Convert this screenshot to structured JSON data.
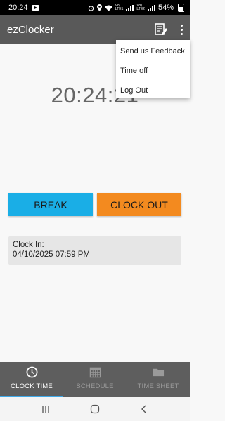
{
  "status_bar": {
    "time": "20:24",
    "battery": "54%",
    "icons": [
      "youtube-icon",
      "alarm-icon",
      "location-icon",
      "wifi-icon",
      "signal-icon",
      "signal-icon",
      "battery-icon"
    ],
    "lte_label_1": "Vo)",
    "lte_label_2": "LTE1",
    "lte_label_3": "Vo)",
    "lte_label_4": "LTE2"
  },
  "app_bar": {
    "title": "ezClocker",
    "actions": [
      "notes-icon",
      "more-vert-icon"
    ]
  },
  "menu": {
    "items": [
      {
        "label": "Send us Feedback"
      },
      {
        "label": "Time off"
      },
      {
        "label": "Log Out"
      }
    ]
  },
  "main": {
    "clock_time": "20:24:21",
    "break_label": "BREAK",
    "clock_out_label": "CLOCK OUT",
    "clock_in_label": "Clock In:",
    "clock_in_value": "04/10/2025 07:59 PM"
  },
  "bottom_nav": {
    "tabs": [
      {
        "label": "CLOCK TIME",
        "icon": "clock-icon",
        "active": true
      },
      {
        "label": "SCHEDULE",
        "icon": "calendar-icon",
        "active": false
      },
      {
        "label": "TIME SHEET",
        "icon": "folder-icon",
        "active": false
      }
    ]
  },
  "system_nav": {
    "buttons": [
      "recent-apps-icon",
      "home-icon",
      "back-icon"
    ]
  },
  "colors": {
    "app_bar": "#595959",
    "break": "#1aaee6",
    "clock_out": "#f38a1f",
    "bottom_nav": "#5e5e5e",
    "active_indicator": "#3fa9e8"
  }
}
